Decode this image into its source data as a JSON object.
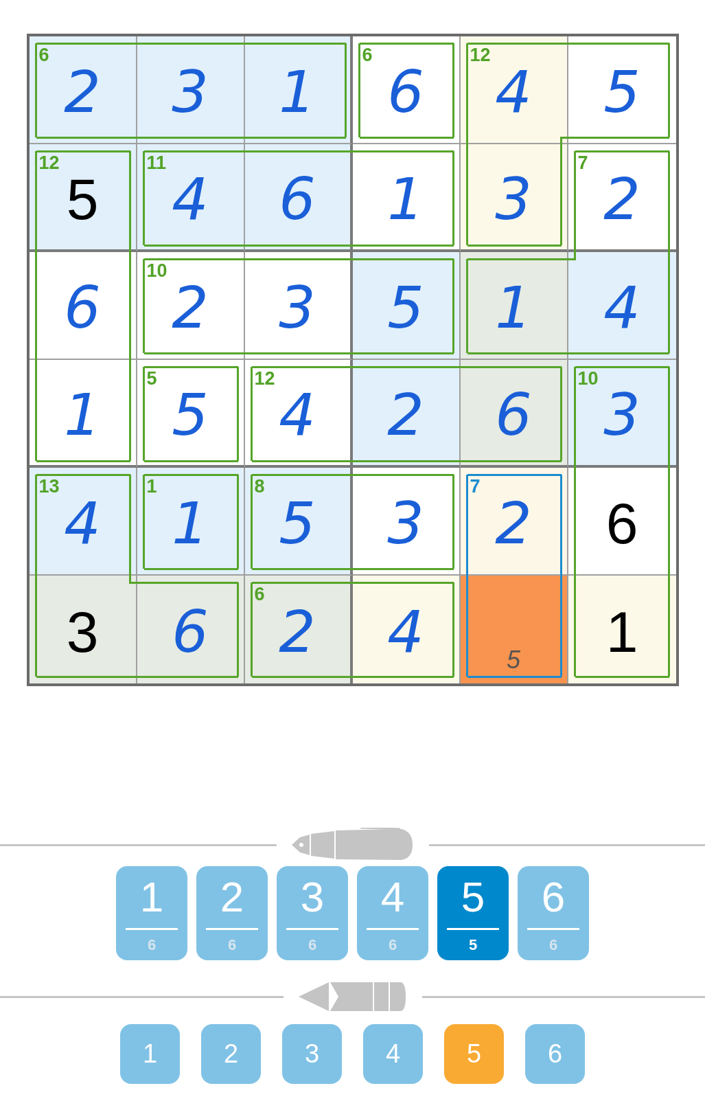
{
  "grid": {
    "rows": [
      {
        "cells": [
          {
            "value": "2",
            "kind": "entered",
            "color": "#e1f0fb",
            "selected": false,
            "cage_sum": "6",
            "edges": {
              "top": true,
              "right": false,
              "bottom": true,
              "left": true
            }
          },
          {
            "value": "3",
            "kind": "entered",
            "color": "#e1f0fb",
            "selected": false,
            "edges": {
              "top": true,
              "right": false,
              "bottom": true,
              "left": false
            }
          },
          {
            "value": "1",
            "kind": "entered",
            "color": "#e1f0fb",
            "selected": false,
            "edges": {
              "top": true,
              "right": true,
              "bottom": true,
              "left": false
            }
          },
          {
            "value": "6",
            "kind": "entered",
            "color": "#ffffff",
            "selected": false,
            "cage_sum": "6",
            "edges": {
              "top": true,
              "right": true,
              "bottom": true,
              "left": true
            }
          },
          {
            "value": "4",
            "kind": "entered",
            "color": "#fdf9e9",
            "selected": false,
            "cage_sum": "12",
            "edges": {
              "top": true,
              "right": false,
              "bottom": false,
              "left": true
            }
          },
          {
            "value": "5",
            "kind": "entered",
            "color": "#ffffff",
            "selected": false,
            "edges": {
              "top": true,
              "right": true,
              "bottom": true,
              "left": false
            }
          }
        ]
      },
      {
        "cells": [
          {
            "value": "5",
            "kind": "given",
            "color": "#e1f0fb",
            "selected": false,
            "cage_sum": "12",
            "edges": {
              "top": true,
              "right": true,
              "bottom": false,
              "left": true
            }
          },
          {
            "value": "4",
            "kind": "entered",
            "color": "#e1f0fb",
            "selected": false,
            "cage_sum": "11",
            "edges": {
              "top": true,
              "right": false,
              "bottom": true,
              "left": true
            }
          },
          {
            "value": "6",
            "kind": "entered",
            "color": "#e1f0fb",
            "selected": false,
            "edges": {
              "top": true,
              "right": false,
              "bottom": true,
              "left": false
            }
          },
          {
            "value": "1",
            "kind": "entered",
            "color": "#ffffff",
            "selected": false,
            "edges": {
              "top": true,
              "right": true,
              "bottom": true,
              "left": false
            }
          },
          {
            "value": "3",
            "kind": "entered",
            "color": "#fdf9e9",
            "selected": false,
            "edges": {
              "top": false,
              "right": true,
              "bottom": true,
              "left": true
            }
          },
          {
            "value": "2",
            "kind": "entered",
            "color": "#ffffff",
            "selected": false,
            "cage_sum": "7",
            "edges": {
              "top": true,
              "right": true,
              "bottom": false,
              "left": true
            }
          }
        ]
      },
      {
        "cells": [
          {
            "value": "6",
            "kind": "entered",
            "color": "#ffffff",
            "selected": false,
            "edges": {
              "top": false,
              "right": true,
              "bottom": false,
              "left": true
            }
          },
          {
            "value": "2",
            "kind": "entered",
            "color": "#ffffff",
            "selected": false,
            "cage_sum": "10",
            "edges": {
              "top": true,
              "right": false,
              "bottom": true,
              "left": true
            }
          },
          {
            "value": "3",
            "kind": "entered",
            "color": "#ffffff",
            "selected": false,
            "edges": {
              "top": true,
              "right": false,
              "bottom": true,
              "left": false
            }
          },
          {
            "value": "5",
            "kind": "entered",
            "color": "#e1f0fb",
            "selected": false,
            "edges": {
              "top": true,
              "right": true,
              "bottom": true,
              "left": false
            }
          },
          {
            "value": "1",
            "kind": "entered",
            "color": "#e6ebe3",
            "selected": false,
            "edges": {
              "top": true,
              "right": false,
              "bottom": true,
              "left": true
            }
          },
          {
            "value": "4",
            "kind": "entered",
            "color": "#e1f0fb",
            "selected": false,
            "edges": {
              "top": false,
              "right": true,
              "bottom": true,
              "left": false
            }
          }
        ]
      },
      {
        "cells": [
          {
            "value": "1",
            "kind": "entered",
            "color": "#ffffff",
            "selected": false,
            "edges": {
              "top": false,
              "right": true,
              "bottom": true,
              "left": true
            }
          },
          {
            "value": "5",
            "kind": "entered",
            "color": "#ffffff",
            "selected": false,
            "cage_sum": "5",
            "edges": {
              "top": true,
              "right": true,
              "bottom": true,
              "left": true
            }
          },
          {
            "value": "4",
            "kind": "entered",
            "color": "#ffffff",
            "selected": false,
            "cage_sum": "12",
            "edges": {
              "top": true,
              "right": false,
              "bottom": true,
              "left": true
            }
          },
          {
            "value": "2",
            "kind": "entered",
            "color": "#e1f0fb",
            "selected": false,
            "edges": {
              "top": true,
              "right": false,
              "bottom": true,
              "left": false
            }
          },
          {
            "value": "6",
            "kind": "entered",
            "color": "#e6ebe3",
            "selected": false,
            "edges": {
              "top": true,
              "right": true,
              "bottom": true,
              "left": false
            }
          },
          {
            "value": "3",
            "kind": "entered",
            "color": "#e1f0fb",
            "selected": false,
            "cage_sum": "10",
            "edges": {
              "top": true,
              "right": true,
              "bottom": false,
              "left": true
            }
          }
        ]
      },
      {
        "cells": [
          {
            "value": "4",
            "kind": "entered",
            "color": "#e1f0fb",
            "selected": false,
            "cage_sum": "13",
            "edges": {
              "top": true,
              "right": true,
              "bottom": false,
              "left": true
            }
          },
          {
            "value": "1",
            "kind": "entered",
            "color": "#e1f0fb",
            "selected": false,
            "cage_sum": "1",
            "edges": {
              "top": true,
              "right": true,
              "bottom": true,
              "left": true
            }
          },
          {
            "value": "5",
            "kind": "entered",
            "color": "#e1f0fb",
            "selected": false,
            "cage_sum": "8",
            "edges": {
              "top": true,
              "right": false,
              "bottom": true,
              "left": true
            }
          },
          {
            "value": "3",
            "kind": "entered",
            "color": "#ffffff",
            "selected": false,
            "edges": {
              "top": true,
              "right": true,
              "bottom": true,
              "left": false
            }
          },
          {
            "value": "2",
            "kind": "entered",
            "color": "#fdf7e8",
            "selected": false,
            "cage_sum": "7",
            "edges": {
              "top": true,
              "right": true,
              "bottom": false,
              "left": true
            }
          },
          {
            "value": "6",
            "kind": "given",
            "color": "#ffffff",
            "selected": false,
            "edges": {
              "top": false,
              "right": true,
              "bottom": false,
              "left": true
            }
          }
        ]
      },
      {
        "cells": [
          {
            "value": "3",
            "kind": "given",
            "color": "#e6ebe3",
            "selected": false,
            "edges": {
              "top": false,
              "right": false,
              "bottom": true,
              "left": true
            }
          },
          {
            "value": "6",
            "kind": "entered",
            "color": "#e6ebe3",
            "selected": false,
            "edges": {
              "top": true,
              "right": true,
              "bottom": true,
              "left": false
            }
          },
          {
            "value": "2",
            "kind": "entered",
            "color": "#e6ebe3",
            "selected": false,
            "cage_sum": "6",
            "edges": {
              "top": true,
              "right": false,
              "bottom": true,
              "left": true
            }
          },
          {
            "value": "4",
            "kind": "entered",
            "color": "#fdf9e9",
            "selected": false,
            "edges": {
              "top": true,
              "right": true,
              "bottom": true,
              "left": false
            }
          },
          {
            "kind": "empty",
            "selected": true,
            "pencil_marks": [
              "5"
            ],
            "edges": {
              "top": false,
              "right": true,
              "bottom": true,
              "left": true
            }
          },
          {
            "value": "1",
            "kind": "given",
            "color": "#fdf9e9",
            "selected": false,
            "edges": {
              "top": false,
              "right": true,
              "bottom": true,
              "left": true
            }
          }
        ]
      }
    ]
  },
  "pen_pad": {
    "keys": [
      {
        "label": "1",
        "count": "6",
        "selected": false
      },
      {
        "label": "2",
        "count": "6",
        "selected": false
      },
      {
        "label": "3",
        "count": "6",
        "selected": false
      },
      {
        "label": "4",
        "count": "6",
        "selected": false
      },
      {
        "label": "5",
        "count": "5",
        "selected": true
      },
      {
        "label": "6",
        "count": "6",
        "selected": false
      }
    ]
  },
  "pencil_pad": {
    "keys": [
      {
        "label": "1",
        "selected": false
      },
      {
        "label": "2",
        "selected": false
      },
      {
        "label": "3",
        "selected": false
      },
      {
        "label": "4",
        "selected": false
      },
      {
        "label": "5",
        "selected": true
      },
      {
        "label": "6",
        "selected": false
      }
    ]
  }
}
